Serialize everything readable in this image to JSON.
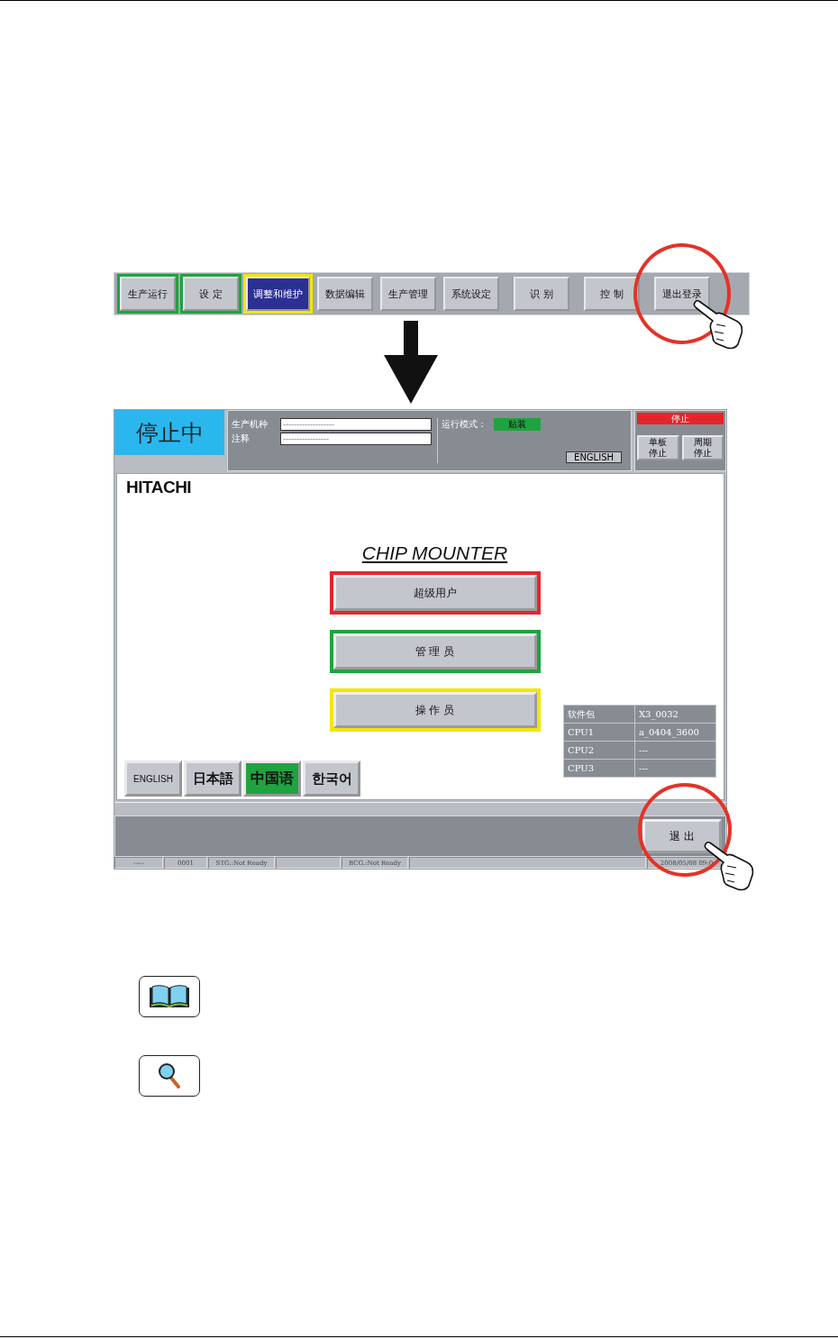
{
  "toolbar": {
    "groups": [
      [
        {
          "label": "生产运行",
          "selected": false,
          "color": "#1fa33f",
          "highlighted": false
        },
        {
          "label": "设 定",
          "selected": false,
          "color": "#1fa33f",
          "highlighted": false
        },
        {
          "label": "调整和维护",
          "selected": true,
          "color": "#f2e600",
          "highlighted": false
        },
        {
          "label": "数据编辑",
          "selected": false,
          "highlighted": false
        },
        {
          "label": "生产管理",
          "selected": false,
          "highlighted": false
        },
        {
          "label": "系统设定",
          "selected": false,
          "highlighted": false
        }
      ],
      [
        {
          "label": "识 别",
          "selected": false,
          "highlighted": false
        }
      ],
      [
        {
          "label": "控 制",
          "selected": false,
          "highlighted": false
        }
      ],
      [
        {
          "label": "退出登录",
          "selected": false,
          "highlighted": true
        }
      ]
    ]
  },
  "screen": {
    "status": "停止中",
    "fields": [
      {
        "label": "生产机种",
        "value": "-------------------"
      },
      {
        "label": "注释",
        "value": "-----------------"
      }
    ],
    "mode": {
      "label": "运行模式：",
      "value": "贴装"
    },
    "language_button": "ENGLISH",
    "stop": {
      "title": "停止",
      "buttons": [
        "单板停止",
        "周期停止"
      ]
    },
    "logo": "HITACHI",
    "title": "CHIP MOUNTER",
    "logins": [
      {
        "label": "超级用户",
        "color": "#e8242b"
      },
      {
        "label": "管 理 员",
        "color": "#1fa33f"
      },
      {
        "label": "操 作 员",
        "color": "#f2e600"
      }
    ],
    "languages": [
      {
        "label": "ENGLISH",
        "selected": false
      },
      {
        "label": "日本語",
        "selected": false
      },
      {
        "label": "中国语",
        "selected": true
      },
      {
        "label": "한국어",
        "selected": false
      }
    ],
    "info": [
      [
        "软件包",
        "X3_0032"
      ],
      [
        "CPU1",
        "a_0404_3600"
      ],
      [
        "CPU2",
        "---"
      ],
      [
        "CPU3",
        "---"
      ]
    ],
    "exit": {
      "label": "退 出",
      "highlighted": true
    },
    "status_bar": [
      "-----",
      "0001",
      "STG.:Not Ready",
      "BCG.:Not Ready",
      "2008/05/08 09:0"
    ]
  }
}
